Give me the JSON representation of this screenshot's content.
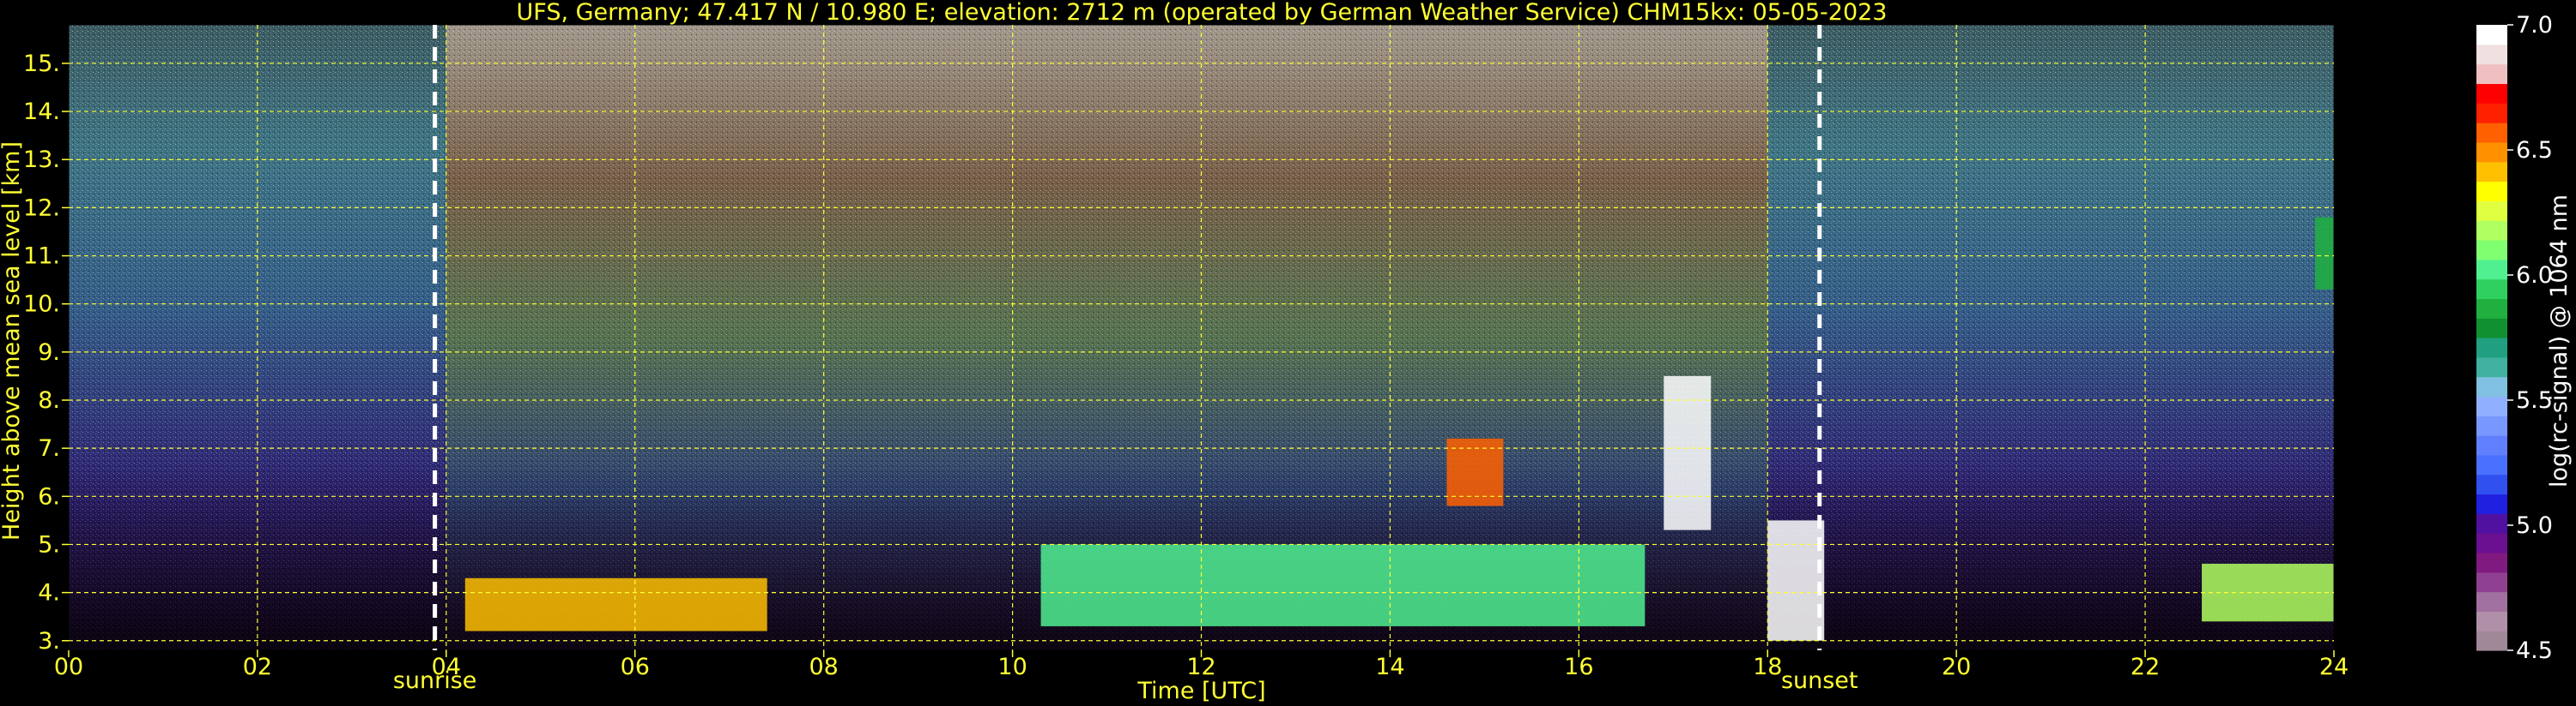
{
  "chart_data": {
    "type": "heatmap",
    "title": "UFS, Germany; 47.417 N / 10.980 E; elevation: 2712 m  (operated by German Weather Service)    CHM15kx: 05-05-2023",
    "xlabel": "Time [UTC]",
    "ylabel": "Height above mean sea level [km]",
    "xlim": [
      0,
      24
    ],
    "ylim": [
      2.8,
      15.8
    ],
    "x_ticks": [
      0,
      2,
      4,
      6,
      8,
      10,
      12,
      14,
      16,
      18,
      20,
      22,
      24
    ],
    "x_tick_labels": [
      "00",
      "02",
      "04",
      "06",
      "08",
      "10",
      "12",
      "14",
      "16",
      "18",
      "20",
      "22",
      "24"
    ],
    "y_ticks": [
      3,
      4,
      5,
      6,
      7,
      8,
      9,
      10,
      11,
      12,
      13,
      14,
      15
    ],
    "y_tick_labels": [
      "3.",
      "4.",
      "5.",
      "6.",
      "7.",
      "8.",
      "9.",
      "10.",
      "11.",
      "12.",
      "13.",
      "14.",
      "15."
    ],
    "grid": true,
    "events": [
      {
        "label": "sunrise",
        "x": 3.88
      },
      {
        "label": "sunset",
        "x": 18.55
      }
    ],
    "colorbar": {
      "label": "log(rc-signal) @ 1064 nm",
      "range": [
        4.5,
        7.0
      ],
      "ticks": [
        4.5,
        5.0,
        5.5,
        6.0,
        6.5,
        7.0
      ],
      "tick_labels": [
        "4.5",
        "5.0",
        "5.5",
        "6.0",
        "6.5",
        "7.0"
      ],
      "colors": [
        "#a08898",
        "#b090a8",
        "#a070a0",
        "#904090",
        "#801a80",
        "#6a1090",
        "#5010a0",
        "#2020e0",
        "#3050f0",
        "#4a70ff",
        "#6080ff",
        "#7898ff",
        "#90b0ff",
        "#80c0e0",
        "#40b0a0",
        "#20a080",
        "#109030",
        "#20b040",
        "#30d060",
        "#50f090",
        "#80ff70",
        "#b0ff60",
        "#e0ff40",
        "#ffff00",
        "#ffc000",
        "#ff9000",
        "#ff6000",
        "#ff2000",
        "#ff0000",
        "#f0c0c0",
        "#f0e0e0",
        "#ffffff"
      ]
    },
    "cloud_layers": [
      {
        "t0": 4.2,
        "t1": 7.4,
        "h0": 3.2,
        "h1": 4.3,
        "level": 6.4
      },
      {
        "t0": 10.3,
        "t1": 16.7,
        "h0": 3.3,
        "h1": 5.0,
        "level": 6.0
      },
      {
        "t0": 14.6,
        "t1": 15.2,
        "h0": 5.8,
        "h1": 7.2,
        "level": 6.6
      },
      {
        "t0": 16.9,
        "t1": 17.4,
        "h0": 5.3,
        "h1": 8.5,
        "level": 7.0
      },
      {
        "t0": 18.0,
        "t1": 18.6,
        "h0": 3.0,
        "h1": 5.5,
        "level": 7.0
      },
      {
        "t0": 22.6,
        "t1": 24.0,
        "h0": 3.4,
        "h1": 4.6,
        "level": 6.2
      },
      {
        "t0": 23.8,
        "t1": 24.0,
        "h0": 10.3,
        "h1": 11.8,
        "level": 5.9
      }
    ]
  }
}
